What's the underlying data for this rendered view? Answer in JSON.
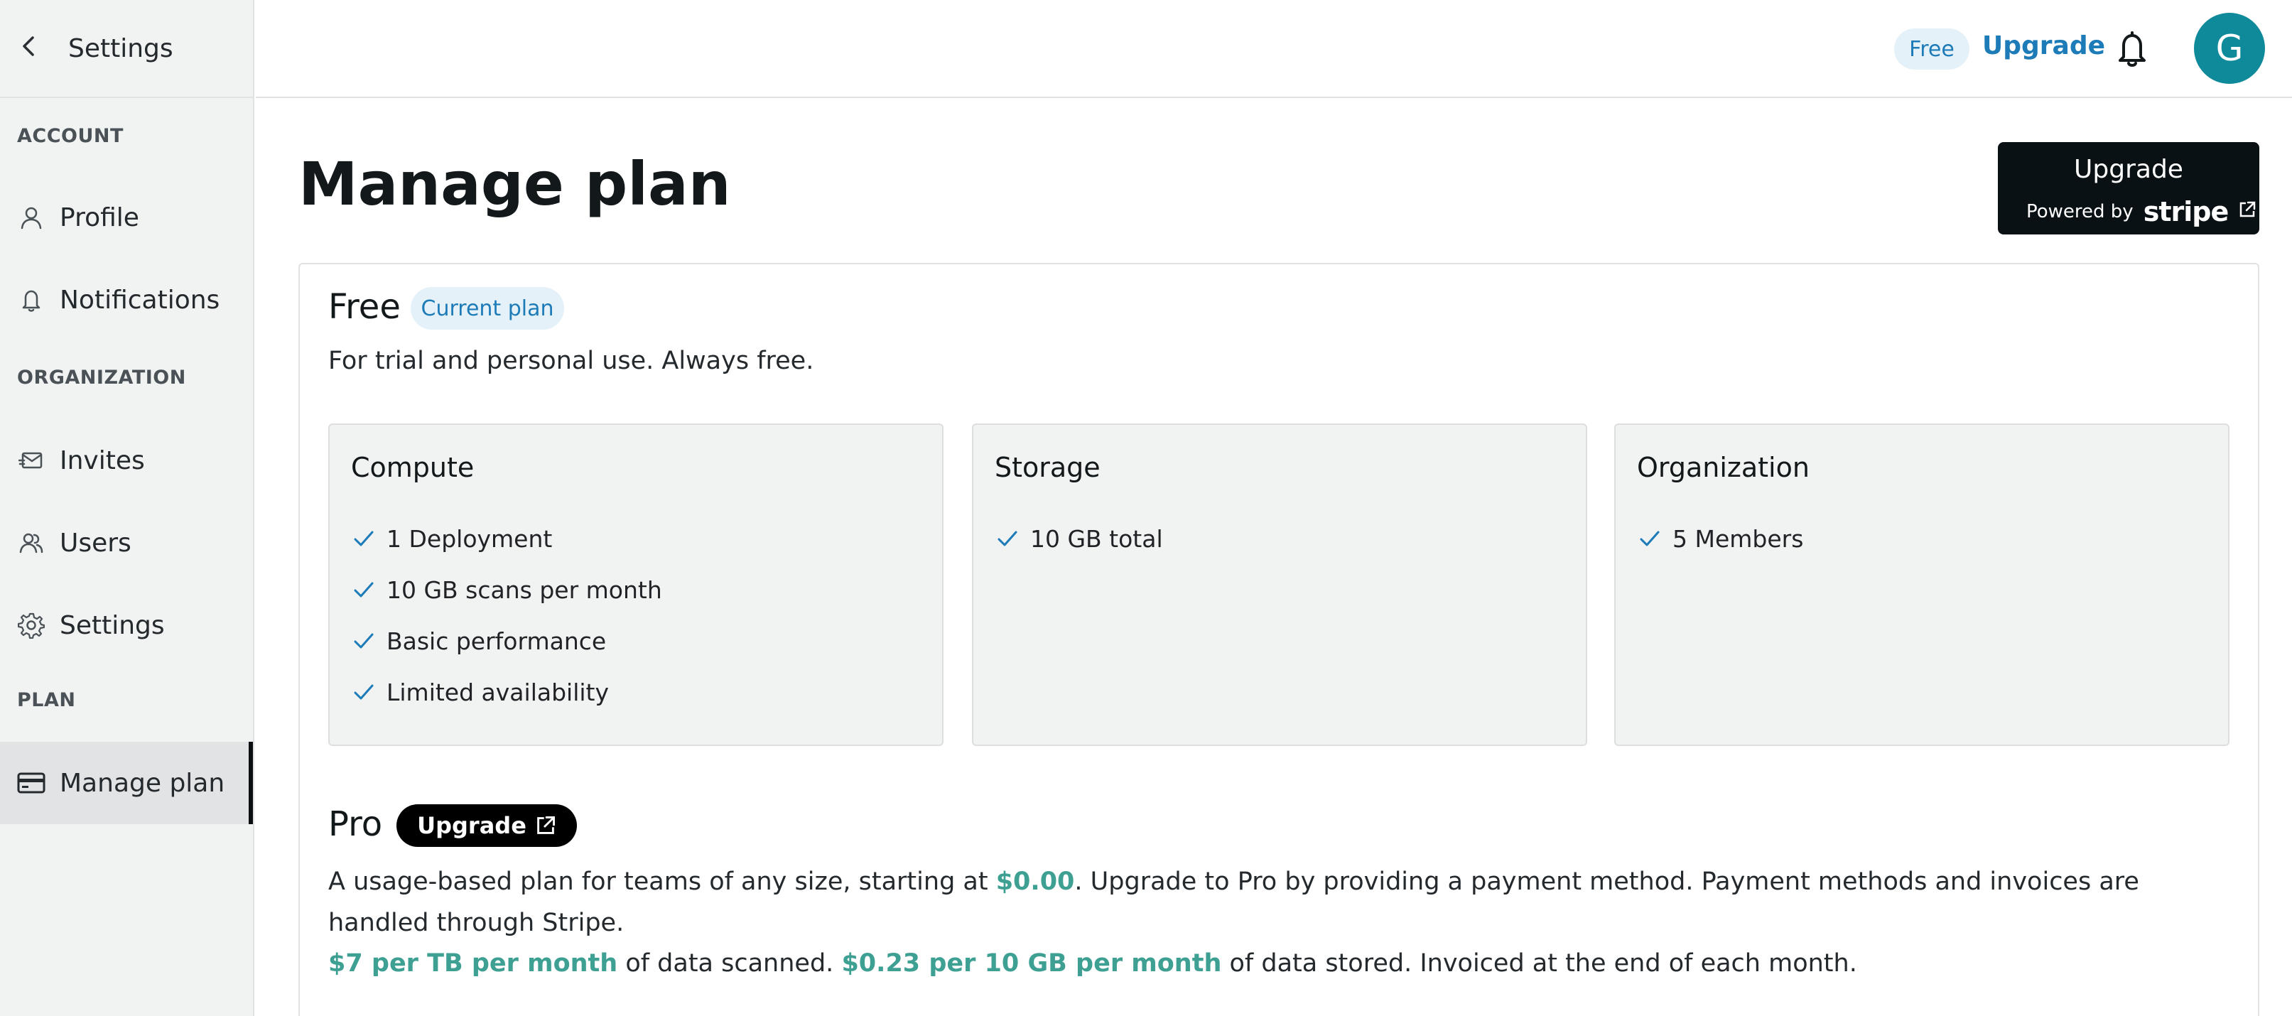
{
  "sidebar": {
    "back_title": "Settings",
    "sections": {
      "account": "ACCOUNT",
      "organization": "ORGANIZATION",
      "plan": "PLAN"
    },
    "items": {
      "profile": "Profile",
      "notifications": "Notifications",
      "invites": "Invites",
      "users": "Users",
      "settings": "Settings",
      "manage_plan": "Manage plan"
    },
    "active_item": "manage_plan"
  },
  "topbar": {
    "plan_badge": "Free",
    "upgrade_link": "Upgrade",
    "avatar_initial": "G",
    "avatar_color": "#0e8a9a"
  },
  "main": {
    "title": "Manage plan",
    "stripe_button": {
      "label": "Upgrade",
      "powered_by": "Powered by",
      "brand": "stripe"
    },
    "current_plan": {
      "name": "Free",
      "badge": "Current plan",
      "description": "For trial and personal use. Always free.",
      "features": [
        {
          "title": "Compute",
          "items": [
            "1 Deployment",
            "10 GB scans per month",
            "Basic performance",
            "Limited availability"
          ]
        },
        {
          "title": "Storage",
          "items": [
            "10 GB total"
          ]
        },
        {
          "title": "Organization",
          "items": [
            "5 Members"
          ]
        }
      ]
    },
    "pro_plan": {
      "name": "Pro",
      "button": "Upgrade",
      "desc_part1": "A usage-based plan for teams of any size, starting at ",
      "desc_price": "$0.00",
      "desc_part2": ". Upgrade to Pro by providing a payment method. Payment methods and invoices are handled through Stripe.",
      "scan_price": "$7 per TB per month",
      "scan_text": " of data scanned. ",
      "storage_price": "$0.23 per 10 GB per month",
      "storage_text": " of data stored. Invoiced at the end of each month."
    }
  },
  "colors": {
    "accent_blue": "#1d7bb8",
    "accent_teal": "#3e9f93",
    "dark": "#0a1114"
  }
}
